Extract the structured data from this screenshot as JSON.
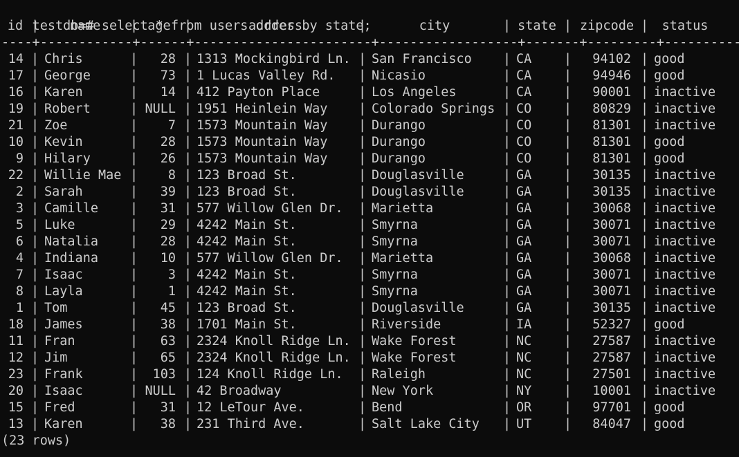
{
  "terminal": {
    "prompt": "testdb=#",
    "command": "select * from users order by state;",
    "divider": "----+------------+------+-----------------------+------------------+-------+---------+----------",
    "footer": "(23 rows)"
  },
  "table": {
    "columns": [
      "id",
      "name",
      "age",
      "address",
      "city",
      "state",
      "zipcode",
      "status"
    ],
    "rows": [
      [
        "14",
        "Chris",
        "28",
        "1313 Mockingbird Ln.",
        "San Francisco",
        "CA",
        "94102",
        "good"
      ],
      [
        "17",
        "George",
        "73",
        "1 Lucas Valley Rd.",
        "Nicasio",
        "CA",
        "94946",
        "good"
      ],
      [
        "16",
        "Karen",
        "14",
        "412 Payton Place",
        "Los Angeles",
        "CA",
        "90001",
        "inactive"
      ],
      [
        "19",
        "Robert",
        "NULL",
        "1951 Heinlein Way",
        "Colorado Springs",
        "CO",
        "80829",
        "inactive"
      ],
      [
        "21",
        "Zoe",
        "7",
        "1573 Mountain Way",
        "Durango",
        "CO",
        "81301",
        "inactive"
      ],
      [
        "10",
        "Kevin",
        "28",
        "1573 Mountain Way",
        "Durango",
        "CO",
        "81301",
        "good"
      ],
      [
        "9",
        "Hilary",
        "26",
        "1573 Mountain Way",
        "Durango",
        "CO",
        "81301",
        "good"
      ],
      [
        "22",
        "Willie Mae",
        "8",
        "123 Broad St.",
        "Douglasville",
        "GA",
        "30135",
        "inactive"
      ],
      [
        "2",
        "Sarah",
        "39",
        "123 Broad St.",
        "Douglasville",
        "GA",
        "30135",
        "inactive"
      ],
      [
        "3",
        "Camille",
        "31",
        "577 Willow Glen Dr.",
        "Marietta",
        "GA",
        "30068",
        "inactive"
      ],
      [
        "5",
        "Luke",
        "29",
        "4242 Main St.",
        "Smyrna",
        "GA",
        "30071",
        "inactive"
      ],
      [
        "6",
        "Natalia",
        "28",
        "4242 Main St.",
        "Smyrna",
        "GA",
        "30071",
        "inactive"
      ],
      [
        "4",
        "Indiana",
        "10",
        "577 Willow Glen Dr.",
        "Marietta",
        "GA",
        "30068",
        "inactive"
      ],
      [
        "7",
        "Isaac",
        "3",
        "4242 Main St.",
        "Smyrna",
        "GA",
        "30071",
        "inactive"
      ],
      [
        "8",
        "Layla",
        "1",
        "4242 Main St.",
        "Smyrna",
        "GA",
        "30071",
        "inactive"
      ],
      [
        "1",
        "Tom",
        "45",
        "123 Broad St.",
        "Douglasville",
        "GA",
        "30135",
        "inactive"
      ],
      [
        "18",
        "James",
        "38",
        "1701 Main St.",
        "Riverside",
        "IA",
        "52327",
        "good"
      ],
      [
        "11",
        "Fran",
        "63",
        "2324 Knoll Ridge Ln.",
        "Wake Forest",
        "NC",
        "27587",
        "inactive"
      ],
      [
        "12",
        "Jim",
        "65",
        "2324 Knoll Ridge Ln.",
        "Wake Forest",
        "NC",
        "27587",
        "inactive"
      ],
      [
        "23",
        "Frank",
        "103",
        "124 Knoll Ridge Ln.",
        "Raleigh",
        "NC",
        "27501",
        "inactive"
      ],
      [
        "20",
        "Isaac",
        "NULL",
        "42 Broadway",
        "New York",
        "NY",
        "10001",
        "inactive"
      ],
      [
        "15",
        "Fred",
        "31",
        "12 LeTour Ave.",
        "Bend",
        "OR",
        "97701",
        "good"
      ],
      [
        "13",
        "Karen",
        "38",
        "231 Third Ave.",
        "Salt Lake City",
        "UT",
        "84047",
        "good"
      ]
    ]
  }
}
